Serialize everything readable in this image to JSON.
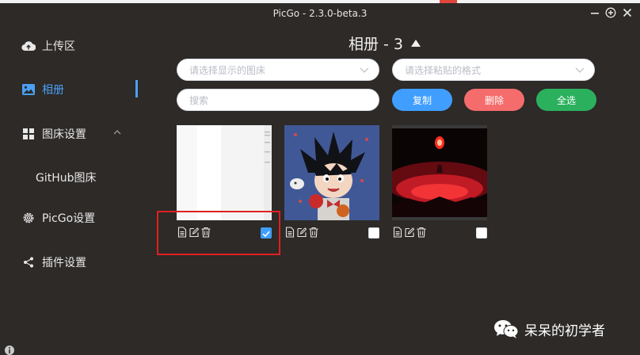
{
  "window": {
    "title": "PicGo - 2.3.0-beta.3",
    "controls": [
      "minimize-icon",
      "add-icon",
      "close-icon"
    ]
  },
  "sidebar": {
    "items": [
      {
        "label": "上传区",
        "icon": "upload-cloud-icon"
      },
      {
        "label": "相册",
        "icon": "image-icon",
        "active": true
      },
      {
        "label": "图床设置",
        "icon": "grid-icon",
        "expanded": true
      },
      {
        "label": "GitHub图床",
        "sub": true
      },
      {
        "label": "PicGo设置",
        "icon": "gear-icon"
      },
      {
        "label": "插件设置",
        "icon": "share-icon"
      }
    ]
  },
  "main": {
    "title": "相册 - 3",
    "filter_select_placeholder": "请选择显示的图床",
    "paste_select_placeholder": "请选择粘贴的格式",
    "search_placeholder": "搜索",
    "buttons": {
      "copy": "复制",
      "delete": "删除",
      "select_all": "全选"
    },
    "images": [
      {
        "name": "screenshot-thumbnail",
        "checked": true
      },
      {
        "name": "goku-thumbnail",
        "checked": false
      },
      {
        "name": "red-sky-thumbnail",
        "checked": false
      }
    ]
  },
  "colors": {
    "background": "#2d2a28",
    "accent": "#409eff",
    "copy": "#409eff",
    "delete": "#f56c6c",
    "select_all": "#2bb15e",
    "highlight_rect": "#e02020"
  },
  "watermark": {
    "text": "呆呆的初学者"
  }
}
